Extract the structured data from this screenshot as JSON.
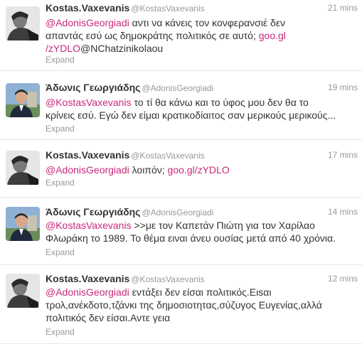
{
  "colors": {
    "link": "#c9287c",
    "muted": "#999999",
    "text": "#333333",
    "divider": "#e8e8e8"
  },
  "tweets": [
    {
      "name": "Kostas.Vaxevanis",
      "handle": "@KostasVaxevanis",
      "time": "21 mins",
      "avatar": "vaxevanis-avatar",
      "lines": [
        [
          {
            "t": "@AdonisGeorgiadi",
            "link": true
          },
          {
            "t": " αντι να κάνεις τον κονφερανσιέ δεν",
            "link": false
          }
        ],
        [
          {
            "t": "απαντάς εσύ ως δημοκράτης πολιτικός σε αυτό; ",
            "link": false
          },
          {
            "t": "goo.gl",
            "link": true
          }
        ],
        [
          {
            "t": "/zYDLO",
            "link": true
          },
          {
            "t": "@NChatzinikolaou",
            "link": false
          }
        ]
      ],
      "expand": "Expand"
    },
    {
      "name": "Άδωνις Γεωργιάδης",
      "handle": "@AdonisGeorgiadi",
      "time": "19 mins",
      "avatar": "georgiadis-avatar",
      "lines": [
        [
          {
            "t": "@KostasVaxevanis",
            "link": true
          },
          {
            "t": " το τί θα κάνω και το ύφος μου δεν θα το",
            "link": false
          }
        ],
        [
          {
            "t": "κρίνεις εσύ. Εγώ δεν είμαι κρατικοδίαιτος σαν μερικούς μερικούς...",
            "link": false
          }
        ]
      ],
      "expand": "Expand"
    },
    {
      "name": "Kostas.Vaxevanis",
      "handle": "@KostasVaxevanis",
      "time": "17 mins",
      "avatar": "vaxevanis-avatar",
      "lines": [
        [
          {
            "t": "@AdonisGeorgiadi",
            "link": true
          },
          {
            "t": " λοιπόν; ",
            "link": false
          },
          {
            "t": "goo.gl/zYDLO",
            "link": true
          }
        ]
      ],
      "expand": "Expand"
    },
    {
      "name": "Άδωνις Γεωργιάδης",
      "handle": "@AdonisGeorgiadi",
      "time": "14 mins",
      "avatar": "georgiadis-avatar",
      "lines": [
        [
          {
            "t": "@KostasVaxevanis",
            "link": true
          },
          {
            "t": " >>με τον Καπετάν Πιώτη για τον Χαρίλαο",
            "link": false
          }
        ],
        [
          {
            "t": "Φλωράκη το 1989. Το θέμα ειναι άνευ ουσίας μετά από 40 χρόνια.",
            "link": false
          }
        ]
      ],
      "expand": "Expand"
    },
    {
      "name": "Kostas.Vaxevanis",
      "handle": "@KostasVaxevanis",
      "time": "12 mins",
      "avatar": "vaxevanis-avatar",
      "lines": [
        [
          {
            "t": "@AdonisGeorgiadi",
            "link": true
          },
          {
            "t": " εντάξει δεν είσαι πολιτικός.Ειsαι",
            "link": false
          }
        ],
        [
          {
            "t": "τρολ,ανέκδοτο,τζάνκι της δημοσιοτητας,σύζυγος Ευγενίας,αλλά",
            "link": false
          }
        ],
        [
          {
            "t": "πολιτικός δεν είσαι.Αντε γεια",
            "link": false
          }
        ]
      ],
      "expand": "Expand"
    }
  ]
}
